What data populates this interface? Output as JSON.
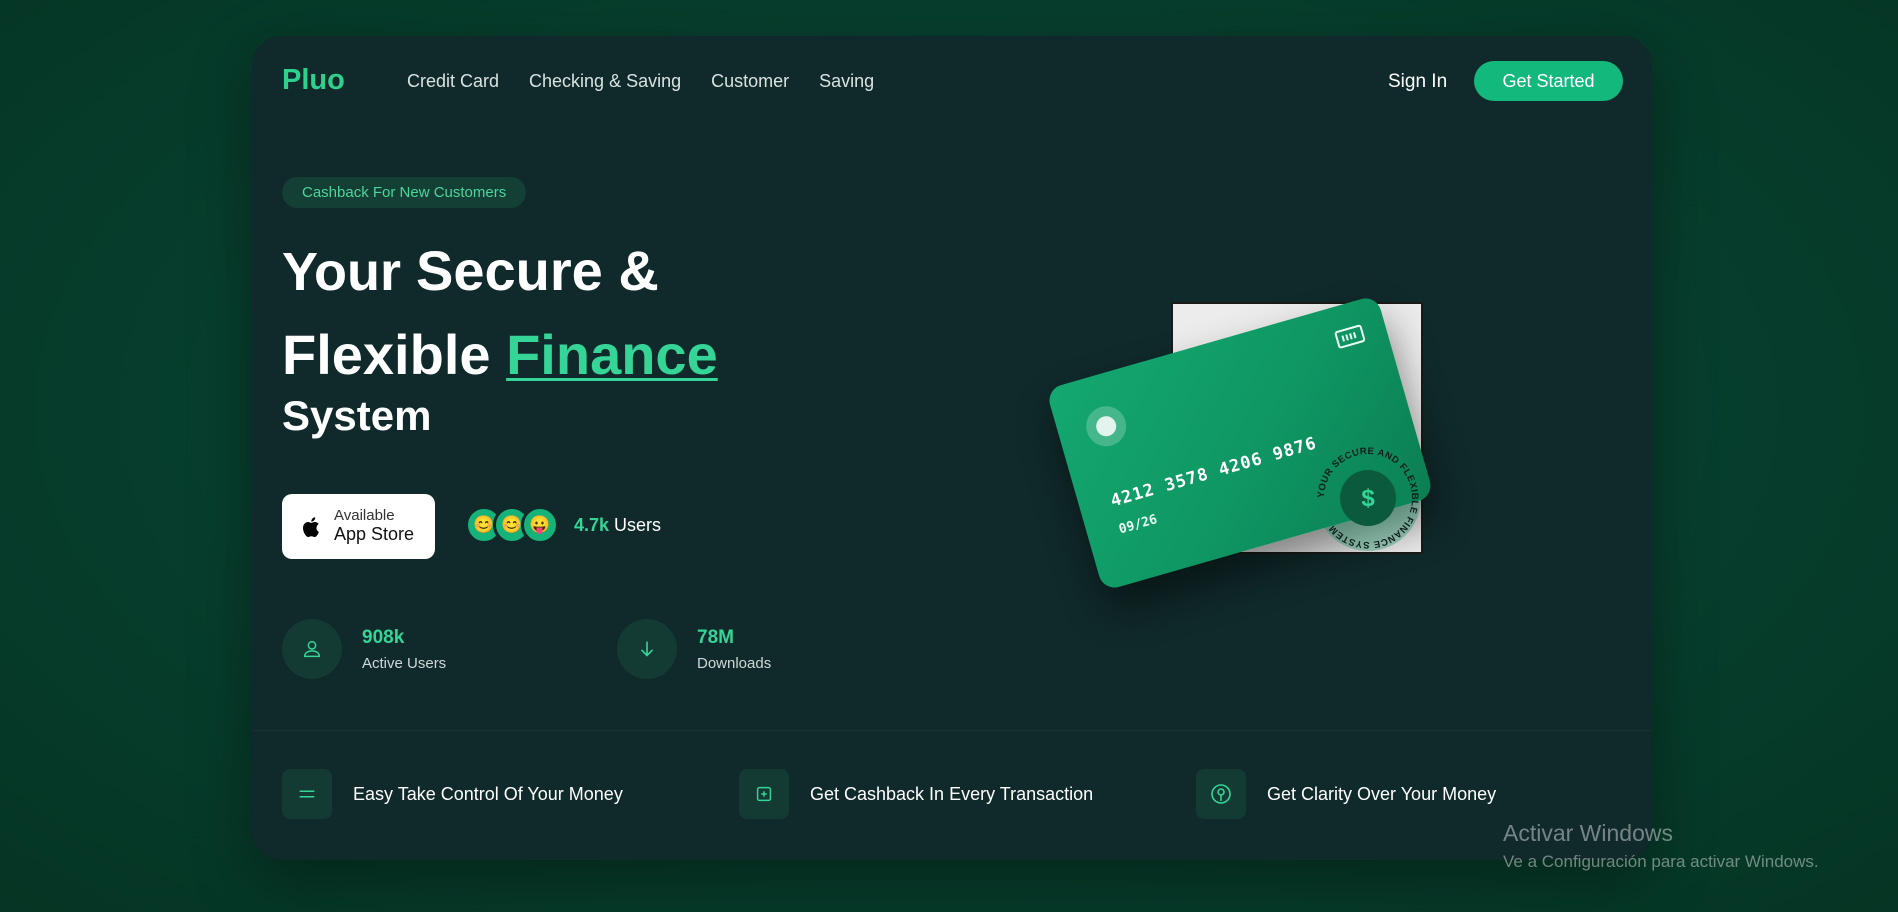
{
  "header": {
    "logo": "Pluo",
    "nav": [
      "Credit Card",
      "Checking & Saving",
      "Customer",
      "Saving"
    ],
    "sign_in": "Sign In",
    "get_started": "Get Started"
  },
  "hero": {
    "badge": "Cashback For New Customers",
    "headline": {
      "line1_a": "Your ",
      "line1_b": "Secure &",
      "line2_a": "Flexible ",
      "line2_accent": "Finance",
      "line3": "System"
    },
    "app_store": {
      "small": "Available",
      "big": "App Store"
    },
    "avatars": [
      "😊",
      "😊",
      "😛"
    ],
    "users": {
      "count": "4.7k",
      "label": " Users"
    },
    "stats": [
      {
        "value": "908k",
        "label": "Active Users",
        "icon": "user-icon"
      },
      {
        "value": "78M",
        "label": "Downloads",
        "icon": "arrow-down-icon"
      }
    ]
  },
  "card": {
    "number": "4212 3578 4206 9876",
    "expiry": "09/26",
    "seal_text": "YOUR SECURE AND FLEXIBLE FINANCE SYSTEM",
    "seal_symbol": "$"
  },
  "features": [
    {
      "label": "Easy Take Control Of Your Money",
      "icon": "menu-lines-icon"
    },
    {
      "label": "Get Cashback In Every Transaction",
      "icon": "plus-square-icon"
    },
    {
      "label": "Get Clarity Over Your Money",
      "icon": "pin-circle-icon"
    }
  ],
  "watermark": {
    "title": "Activar Windows",
    "subtitle": "Ve a Configuración para activar Windows."
  },
  "colors": {
    "accent": "#35d497",
    "button": "#13b87c",
    "panel": "#10292a",
    "background": "#07402f"
  }
}
